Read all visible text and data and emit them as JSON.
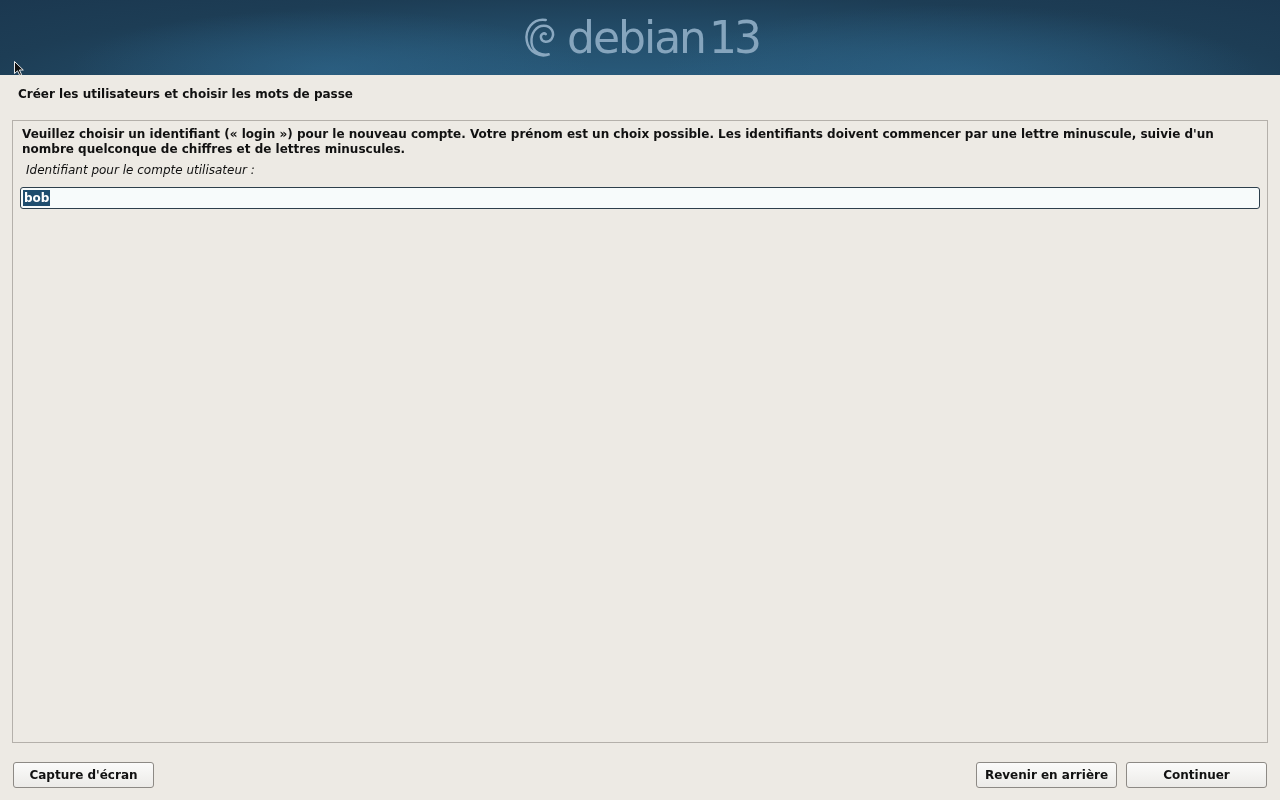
{
  "header": {
    "logo_text": "debian",
    "version": "13"
  },
  "title": "Créer les utilisateurs et choisir les mots de passe",
  "panel": {
    "description": "Veuillez choisir un identifiant (« login ») pour le nouveau compte. Votre prénom est un choix possible. Les identifiants doivent commencer par une lettre minuscule, suivie d'un nombre quelconque de chiffres et de lettres minuscules.",
    "field": {
      "label": "Identifiant pour le compte utilisateur :",
      "value": "bob",
      "value_selected": true
    }
  },
  "footer": {
    "left_buttons": [
      "Capture d'écran"
    ],
    "right_buttons": [
      "Revenir en arrière",
      "Continuer"
    ]
  }
}
